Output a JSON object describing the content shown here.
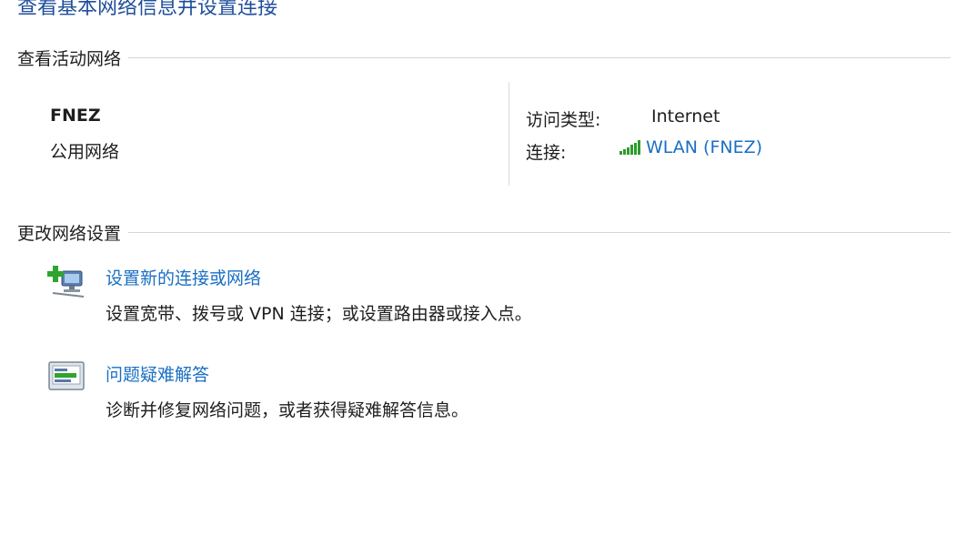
{
  "header": {
    "title": "查看基本网络信息并设置连接"
  },
  "active_networks": {
    "section_title": "查看活动网络",
    "network_name": "FNEZ",
    "network_category": "公用网络",
    "access_type_label": "访问类型:",
    "access_type_value": "Internet",
    "connections_label": "连接:",
    "connection_link": "WLAN (FNEZ)"
  },
  "change_settings": {
    "section_title": "更改网络设置",
    "tasks": [
      {
        "link": "设置新的连接或网络",
        "description": "设置宽带、拨号或 VPN 连接；或设置路由器或接入点。",
        "icon": "new-connection-icon"
      },
      {
        "link": "问题疑难解答",
        "description": "诊断并修复网络问题，或者获得疑难解答信息。",
        "icon": "troubleshoot-icon"
      }
    ]
  },
  "colors": {
    "link": "#1a6fc4",
    "title": "#1f4e9c",
    "signal": "#2e9b2e"
  }
}
